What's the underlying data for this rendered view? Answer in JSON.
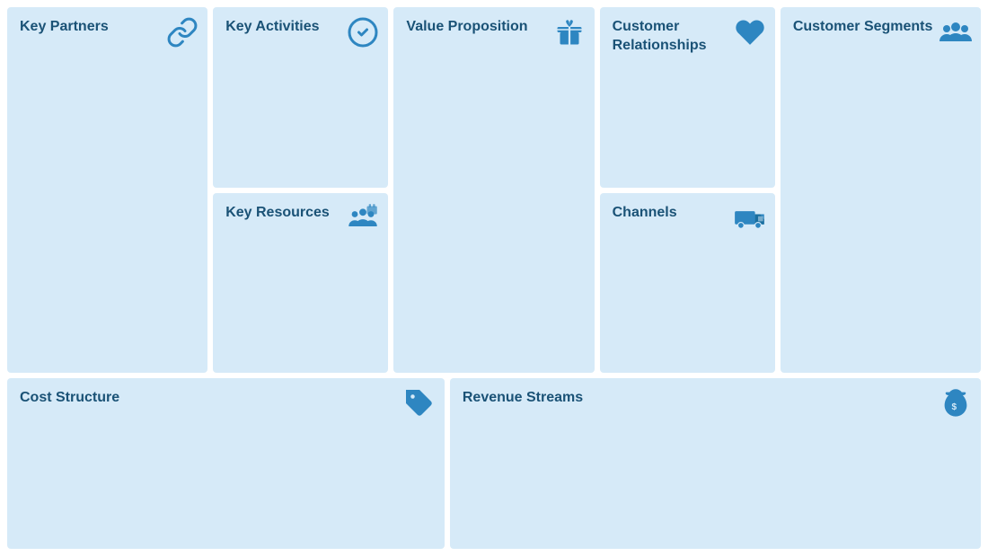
{
  "cells": {
    "key_partners": {
      "title": "Key\nPartners",
      "icon": "link"
    },
    "key_activities": {
      "title": "Key\nActivities",
      "icon": "check-circle"
    },
    "key_resources": {
      "title": "Key\nResources",
      "icon": "factory-people"
    },
    "value_proposition": {
      "title": "Value\nProposition",
      "icon": "gift"
    },
    "customer_relationships": {
      "title": "Customer\nRelationships",
      "icon": "heart"
    },
    "channels": {
      "title": "Channels",
      "icon": "truck"
    },
    "customer_segments": {
      "title": "Customer\nSegments",
      "icon": "people"
    },
    "cost_structure": {
      "title": "Cost Structure",
      "icon": "tag"
    },
    "revenue_streams": {
      "title": "Revenue Streams",
      "icon": "money-bag"
    }
  }
}
